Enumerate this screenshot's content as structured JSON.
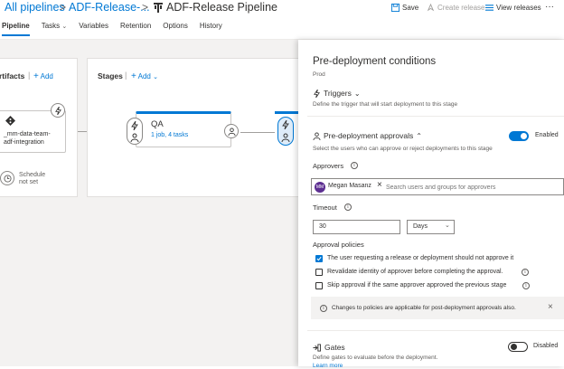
{
  "header": {
    "breadcrumb": [
      "All pipelines",
      "ADF-Release-..."
    ],
    "separator": ">",
    "pipeline_title": "ADF-Release Pipeline",
    "actions": [
      {
        "label": "Save",
        "icon": "save-icon",
        "enabled": true
      },
      {
        "label": "Create release",
        "icon": "rocket-icon",
        "enabled": false
      },
      {
        "label": "View releases",
        "icon": "list-icon",
        "enabled": true
      }
    ],
    "more": "···"
  },
  "tabs": [
    {
      "label": "Pipeline",
      "active": true
    },
    {
      "label": "Tasks",
      "dropdown": true
    },
    {
      "label": "Variables"
    },
    {
      "label": "Retention"
    },
    {
      "label": "Options"
    },
    {
      "label": "History"
    }
  ],
  "artifacts": {
    "title": "rtifacts",
    "add_label": "Add",
    "artifact_name_line1": "_mm-data-team-",
    "artifact_name_line2": "adf-integration",
    "schedule_line1": "Schedule",
    "schedule_line2": "not set"
  },
  "stages": {
    "title": "Stages",
    "add_label": "Add",
    "stage_name": "QA",
    "stage_detail": "1 job, 4 tasks"
  },
  "pane": {
    "title": "Pre-deployment conditions",
    "subtitle": "Prod",
    "triggers": {
      "label": "Triggers",
      "description": "Define the trigger that will start deployment to this stage"
    },
    "approvals": {
      "label": "Pre-deployment approvals",
      "toggle_label": "Enabled",
      "enabled": true,
      "description": "Select the users who can approve or reject deployments to this stage",
      "approvers_label": "Approvers",
      "approver_initials": "MM",
      "approver_name": "Megan Masanz",
      "search_placeholder": "Search users and groups for approvers",
      "timeout_label": "Timeout",
      "timeout_value": "30",
      "timeout_unit": "Days",
      "policies_label": "Approval policies",
      "policies": [
        {
          "label": "The user requesting a release or deployment should not approve it",
          "checked": true,
          "info": false
        },
        {
          "label": "Revalidate identity of approver before completing the approval.",
          "checked": false,
          "info": true
        },
        {
          "label": "Skip approval if the same approver approved the previous stage",
          "checked": false,
          "info": true
        }
      ],
      "notice": "Changes to policies are applicable for post-deployment approvals also."
    },
    "gates": {
      "label": "Gates",
      "toggle_label": "Disabled",
      "enabled": false,
      "description": "Define gates to evaluate before the deployment.",
      "learn_more": "Learn more"
    }
  },
  "colors": {
    "accent": "#0078d4",
    "canvas_bg": "#f3f2f1",
    "avatar": "#5c2e91"
  }
}
